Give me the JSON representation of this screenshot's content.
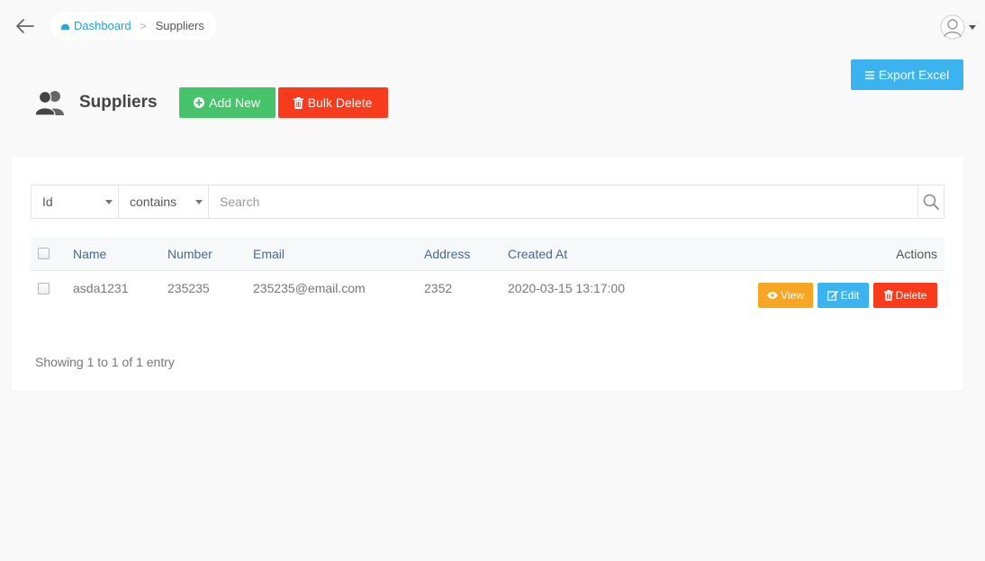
{
  "breadcrumb": {
    "home": "Dashboard",
    "current": "Suppliers"
  },
  "header": {
    "title": "Suppliers",
    "add_label": "Add New",
    "bulk_delete_label": "Bulk Delete",
    "export_label": "Export Excel"
  },
  "search": {
    "field_value": "Id",
    "operator_value": "contains",
    "placeholder": "Search"
  },
  "table": {
    "columns": [
      "Name",
      "Number",
      "Email",
      "Address",
      "Created At",
      "Actions"
    ],
    "rows": [
      {
        "name": "asda1231",
        "number": "235235",
        "email": "235235@email.com",
        "address": "2352",
        "created_at": "2020-03-15 13:17:00"
      }
    ],
    "actions": {
      "view": "View",
      "edit": "Edit",
      "delete": "Delete"
    }
  },
  "footer": {
    "info": "Showing 1 to 1 of 1 entry"
  },
  "colors": {
    "add": "#47c36b",
    "danger": "#f73b1c",
    "info": "#3bb3ee",
    "warning": "#f6a623",
    "link": "#2a9fd8"
  },
  "icons": {
    "back": "arrow-left-icon",
    "home": "dashboard-icon",
    "user": "user-avatar-icon",
    "page": "users-icon",
    "add": "plus-circle-icon",
    "bulk": "trash-icon",
    "export": "list-icon",
    "search": "search-icon",
    "view": "eye-icon",
    "edit": "edit-icon",
    "delete": "trash-icon"
  }
}
